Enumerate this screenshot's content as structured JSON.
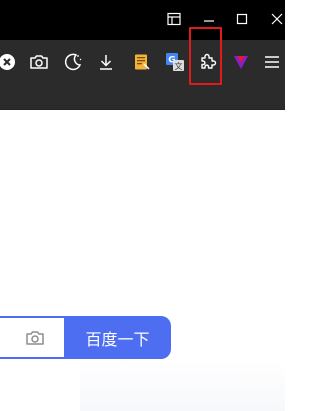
{
  "titlebar": {
    "buttons": [
      "sidebar-toggle",
      "minimize",
      "maximize",
      "close"
    ]
  },
  "toolbar": {
    "icons": [
      "close-circle-icon",
      "camera-icon",
      "night-mode-icon",
      "download-icon",
      "notes-extension-icon",
      "translate-extension-icon",
      "extensions-puzzle-icon",
      "vivaldi-icon",
      "menu-icon"
    ],
    "highlighted": "extensions-puzzle-icon"
  },
  "search": {
    "button_label": "百度一下",
    "camera_icon": "camera-icon",
    "button_color": "#4e6ef2"
  },
  "colors": {
    "titlebar_bg": "#000000",
    "toolbar_bg": "#2b2b2b",
    "highlight": "#e11a1a",
    "accent": "#4e6ef2"
  }
}
